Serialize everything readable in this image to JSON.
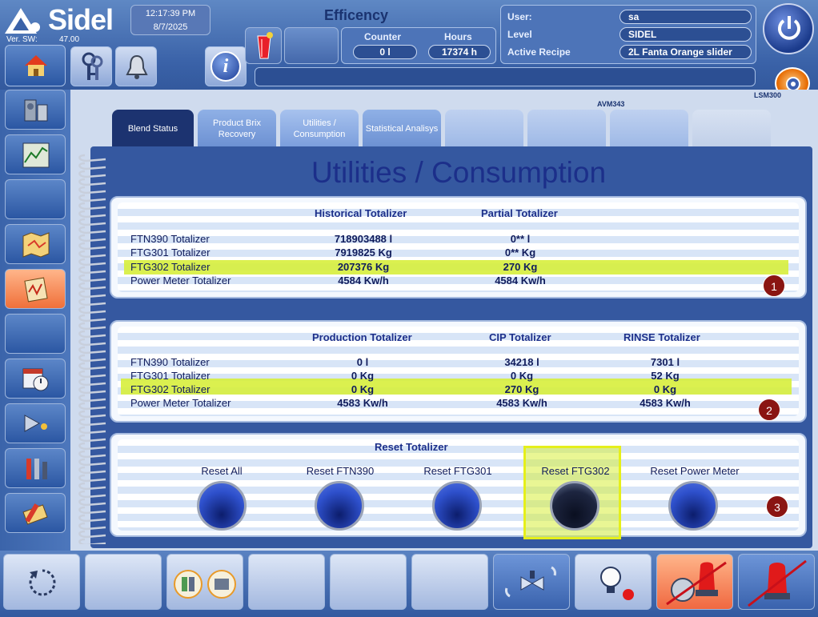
{
  "header": {
    "logo_text": "Sidel",
    "version_label": "Ver. SW:",
    "version_value": "47.00",
    "time": "12:17:39 PM",
    "date": "8/7/2025",
    "title": "Efficency",
    "counter_label": "Counter",
    "counter_value": "0 l",
    "hours_label": "Hours",
    "hours_value": "17374 h",
    "user_label": "User:",
    "user_value": "sa",
    "level_label": "Level",
    "level_value": "SIDEL",
    "recipe_label": "Active Recipe",
    "recipe_value": "2L Fanta Orange slider",
    "lsm_label": "LSM300",
    "avm_label": "AVM343",
    "info_glyph": "i"
  },
  "tabs": [
    {
      "label": "Blend Status"
    },
    {
      "label": "Product Brix Recovery"
    },
    {
      "label": "Utilities / Consumption"
    },
    {
      "label": "Statistical Analisys"
    }
  ],
  "page_title": "Utilities / Consumption",
  "section1": {
    "col_headers": [
      "Historical Totalizer",
      "Partial Totalizer"
    ],
    "rows": [
      {
        "name": "FTN390 Totalizer",
        "historical": "718903488 l",
        "partial": "0** l"
      },
      {
        "name": "FTG301 Totalizer",
        "historical": "7919825 Kg",
        "partial": "0** Kg"
      },
      {
        "name": "FTG302 Totalizer",
        "historical": "207376 Kg",
        "partial": "270 Kg"
      },
      {
        "name": "Power Meter Totalizer",
        "historical": "4584 Kw/h",
        "partial": "4584 Kw/h"
      }
    ],
    "badge": "1"
  },
  "section2": {
    "col_headers": [
      "Production Totalizer",
      "CIP Totalizer",
      "RINSE Totalizer"
    ],
    "rows": [
      {
        "name": "FTN390 Totalizer",
        "production": "0 l",
        "cip": "34218 l",
        "rinse": "7301 l"
      },
      {
        "name": "FTG301 Totalizer",
        "production": "0 Kg",
        "cip": "0 Kg",
        "rinse": "52 Kg"
      },
      {
        "name": "FTG302 Totalizer",
        "production": "0 Kg",
        "cip": "270 Kg",
        "rinse": "0 Kg"
      },
      {
        "name": "Power Meter Totalizer",
        "production": "4583 Kw/h",
        "cip": "4583 Kw/h",
        "rinse": "4583 Kw/h"
      }
    ],
    "badge": "2"
  },
  "section3": {
    "title": "Reset Totalizer",
    "buttons": [
      {
        "label": "Reset All"
      },
      {
        "label": "Reset FTN390"
      },
      {
        "label": "Reset FTG301"
      },
      {
        "label": "Reset FTG302"
      },
      {
        "label": "Reset Power Meter"
      }
    ],
    "badge": "3"
  },
  "colors": {
    "highlight": "#d7ee3c",
    "badge": "#8a1512",
    "title": "#1c2f8a"
  },
  "icons": {
    "top": [
      "home-icon",
      "keys-icon",
      "bell-icon",
      "info-icon",
      "power-icon",
      "gear-icon"
    ],
    "side": [
      "machine-icon",
      "trend-chart-icon",
      "map-icon",
      "diagnostic-icon",
      "calendar-clock-icon",
      "lamp-icon",
      "tools-icon",
      "maintenance-icon"
    ],
    "footer": [
      "refresh-icon",
      "bottles-icon",
      "valve-icon",
      "lightbulb-icon",
      "alarm-off-icon",
      "beacon-off-icon"
    ]
  }
}
